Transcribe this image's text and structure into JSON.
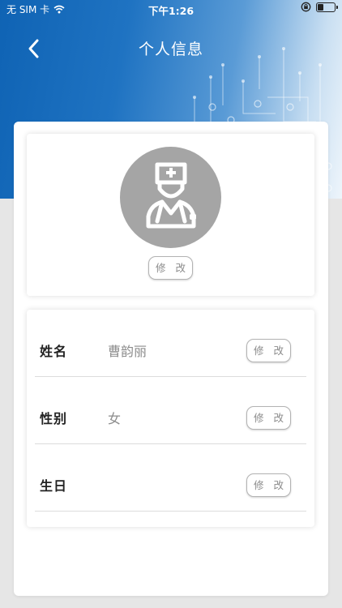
{
  "status_bar": {
    "carrier": "无 SIM 卡",
    "time": "下午1:26",
    "battery_fraction": 0.35
  },
  "header": {
    "title": "个人信息",
    "back_icon": "chevron-left-icon"
  },
  "avatar_section": {
    "avatar_icon": "doctor-avatar-icon",
    "edit_label": "修 改"
  },
  "info_rows": [
    {
      "label": "姓名",
      "value": "曹韵丽",
      "edit_label": "修 改"
    },
    {
      "label": "性别",
      "value": "女",
      "edit_label": "修 改"
    },
    {
      "label": "生日",
      "value": "",
      "edit_label": "修 改"
    }
  ],
  "colors": {
    "header_blue": "#1468b8",
    "avatar_bg": "#a5a5a5",
    "page_bg": "#e6e6e6"
  }
}
